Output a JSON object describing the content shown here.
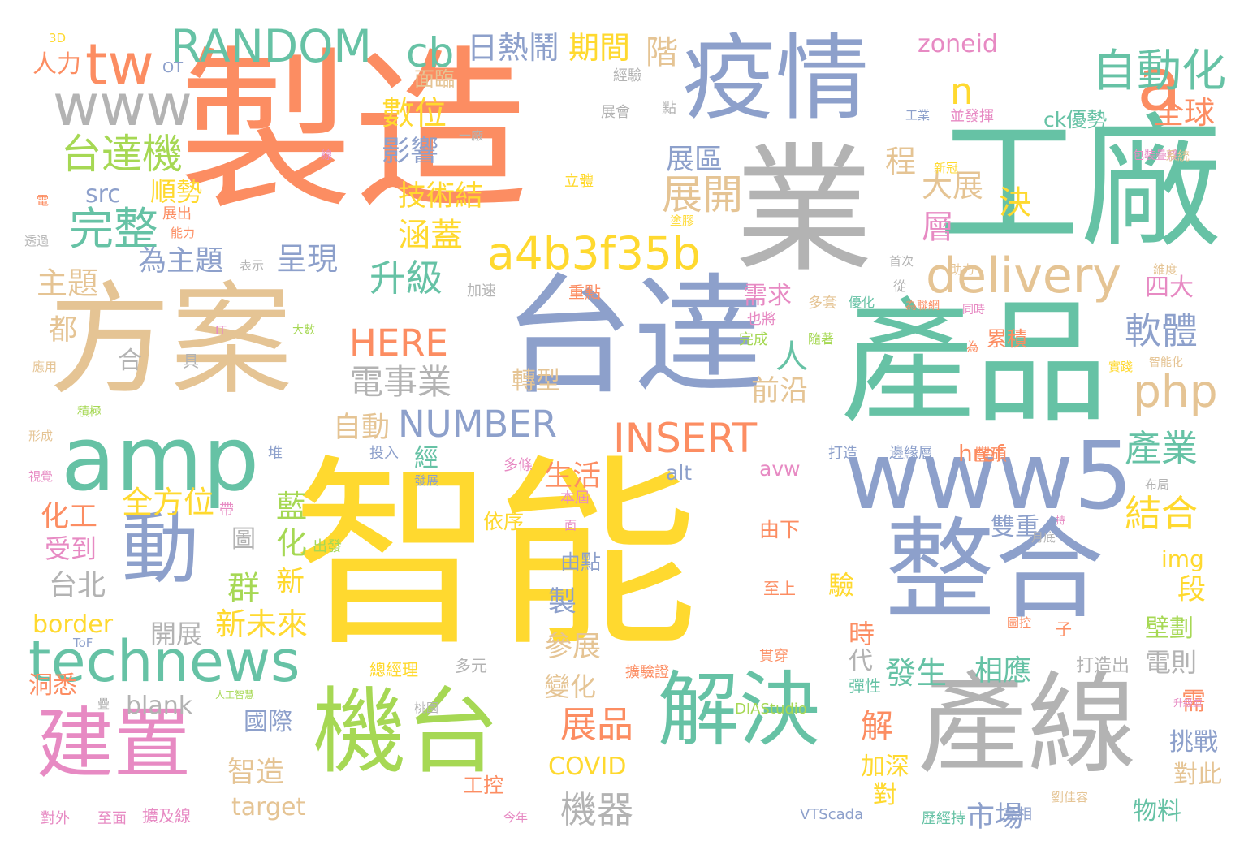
{
  "palette": {
    "orange": "#fc8d62",
    "green": "#66c2a5",
    "blue": "#8da0cb",
    "pink": "#e78ac3",
    "lime": "#a6d854",
    "yellow": "#ffd92f",
    "tan": "#e5c494",
    "gray": "#b3b3b3"
  },
  "words": [
    {
      "text": "智能",
      "color": "yellow"
    },
    {
      "text": "製造",
      "color": "orange"
    },
    {
      "text": "業",
      "color": "gray"
    },
    {
      "text": "工廠",
      "color": "green"
    },
    {
      "text": "疫情",
      "color": "blue"
    },
    {
      "text": "方案",
      "color": "tan"
    },
    {
      "text": "台達",
      "color": "blue"
    },
    {
      "text": "產品",
      "color": "green"
    },
    {
      "text": "產線",
      "color": "gray"
    },
    {
      "text": "整合",
      "color": "blue"
    },
    {
      "text": "機台",
      "color": "lime"
    },
    {
      "text": "解決",
      "color": "green"
    },
    {
      "text": "amp",
      "color": "green"
    },
    {
      "text": "www5",
      "color": "blue"
    },
    {
      "text": "建置",
      "color": "pink"
    },
    {
      "text": "動",
      "color": "blue"
    },
    {
      "text": "technews",
      "color": "green"
    },
    {
      "text": "a",
      "color": "orange"
    },
    {
      "text": "www",
      "color": "gray"
    },
    {
      "text": "tw",
      "color": "orange"
    },
    {
      "text": "RANDOM",
      "color": "green"
    },
    {
      "text": "a4b3f35b",
      "color": "yellow"
    },
    {
      "text": "delivery",
      "color": "tan"
    },
    {
      "text": "自動化",
      "color": "green"
    },
    {
      "text": "INSERT",
      "color": "orange"
    },
    {
      "text": "NUMBER",
      "color": "blue"
    },
    {
      "text": "HERE",
      "color": "orange"
    },
    {
      "text": "cb",
      "color": "green"
    },
    {
      "text": "n",
      "color": "yellow"
    },
    {
      "text": "php",
      "color": "tan"
    },
    {
      "text": "台達機",
      "color": "lime"
    },
    {
      "text": "完整",
      "color": "green"
    },
    {
      "text": "電事業",
      "color": "gray"
    },
    {
      "text": "展開",
      "color": "tan"
    },
    {
      "text": "升級",
      "color": "green"
    },
    {
      "text": "軟體",
      "color": "blue"
    },
    {
      "text": "結合",
      "color": "yellow"
    },
    {
      "text": "產業",
      "color": "green"
    },
    {
      "text": "展品",
      "color": "orange"
    },
    {
      "text": "機器",
      "color": "gray"
    },
    {
      "text": "日熱鬧",
      "color": "blue"
    },
    {
      "text": "期間",
      "color": "yellow"
    },
    {
      "text": "階",
      "color": "tan"
    },
    {
      "text": "數位",
      "color": "yellow"
    },
    {
      "text": "大展",
      "color": "tan"
    },
    {
      "text": "全球",
      "color": "orange"
    },
    {
      "text": "影響",
      "color": "blue"
    },
    {
      "text": "展區",
      "color": "blue"
    },
    {
      "text": "技術結",
      "color": "yellow"
    },
    {
      "text": "程",
      "color": "tan"
    },
    {
      "text": "決",
      "color": "yellow"
    },
    {
      "text": "層",
      "color": "pink"
    },
    {
      "text": "涵蓋",
      "color": "yellow"
    },
    {
      "text": "呈現",
      "color": "blue"
    },
    {
      "text": "為主題",
      "color": "blue"
    },
    {
      "text": "順勢",
      "color": "yellow"
    },
    {
      "text": "src",
      "color": "blue"
    },
    {
      "text": "主題",
      "color": "tan"
    },
    {
      "text": "人力",
      "color": "orange"
    },
    {
      "text": "都",
      "color": "tan"
    },
    {
      "text": "合",
      "color": "gray"
    },
    {
      "text": "人",
      "color": "green"
    },
    {
      "text": "四大",
      "color": "pink"
    },
    {
      "text": "需求",
      "color": "pink"
    },
    {
      "text": "前沿",
      "color": "tan"
    },
    {
      "text": "轉型",
      "color": "tan"
    },
    {
      "text": "自動",
      "color": "tan"
    },
    {
      "text": "全方位",
      "color": "yellow"
    },
    {
      "text": "化工",
      "color": "orange"
    },
    {
      "text": "受到",
      "color": "pink"
    },
    {
      "text": "台北",
      "color": "gray"
    },
    {
      "text": "群",
      "color": "lime"
    },
    {
      "text": "新",
      "color": "yellow"
    },
    {
      "text": "藍",
      "color": "lime"
    },
    {
      "text": "化",
      "color": "lime"
    },
    {
      "text": "經",
      "color": "green"
    },
    {
      "text": "生活",
      "color": "orange"
    },
    {
      "text": "新未來",
      "color": "yellow"
    },
    {
      "text": "開展",
      "color": "gray"
    },
    {
      "text": "參展",
      "color": "tan"
    },
    {
      "text": "變化",
      "color": "tan"
    },
    {
      "text": "border",
      "color": "yellow"
    },
    {
      "text": "blank",
      "color": "gray"
    },
    {
      "text": "國際",
      "color": "blue"
    },
    {
      "text": "智造",
      "color": "tan"
    },
    {
      "text": "target",
      "color": "tan"
    },
    {
      "text": "COVID",
      "color": "yellow"
    },
    {
      "text": "alt",
      "color": "blue"
    },
    {
      "text": "avw",
      "color": "pink"
    },
    {
      "text": "href",
      "color": "orange"
    },
    {
      "text": "img",
      "color": "yellow"
    },
    {
      "text": "段",
      "color": "yellow"
    },
    {
      "text": "壁劃",
      "color": "lime"
    },
    {
      "text": "雙重",
      "color": "blue"
    },
    {
      "text": "驗",
      "color": "yellow"
    },
    {
      "text": "時",
      "color": "orange"
    },
    {
      "text": "代",
      "color": "gray"
    },
    {
      "text": "發生",
      "color": "green"
    },
    {
      "text": "相應",
      "color": "green"
    },
    {
      "text": "電則",
      "color": "gray"
    },
    {
      "text": "解",
      "color": "orange"
    },
    {
      "text": "加深",
      "color": "yellow"
    },
    {
      "text": "對",
      "color": "yellow"
    },
    {
      "text": "需",
      "color": "orange"
    },
    {
      "text": "挑戰",
      "color": "blue"
    },
    {
      "text": "對此",
      "color": "tan"
    },
    {
      "text": "物料",
      "color": "green"
    },
    {
      "text": "市場",
      "color": "blue"
    },
    {
      "text": "製",
      "color": "blue"
    },
    {
      "text": "zoneid",
      "color": "pink"
    },
    {
      "text": "ck優勢",
      "color": "green"
    },
    {
      "text": "圖",
      "color": "gray"
    },
    {
      "text": "洞悉",
      "color": "orange"
    },
    {
      "text": "3D",
      "color": "yellow"
    },
    {
      "text": "OT",
      "color": "blue"
    },
    {
      "text": "經驗",
      "color": "gray"
    },
    {
      "text": "面臨",
      "color": "tan"
    },
    {
      "text": "展會",
      "color": "gray"
    },
    {
      "text": "點",
      "color": "gray"
    },
    {
      "text": "工業",
      "color": "blue"
    },
    {
      "text": "並發揮",
      "color": "pink"
    },
    {
      "text": "包裝疊棧",
      "color": "pink"
    },
    {
      "text": "系統",
      "color": "tan"
    },
    {
      "text": "新冠",
      "color": "yellow"
    },
    {
      "text": "立體",
      "color": "yellow"
    },
    {
      "text": "一廠",
      "color": "gray"
    },
    {
      "text": "線",
      "color": "pink"
    },
    {
      "text": "電",
      "color": "orange"
    },
    {
      "text": "展出",
      "color": "orange"
    },
    {
      "text": "能力",
      "color": "orange"
    },
    {
      "text": "透過",
      "color": "gray"
    },
    {
      "text": "塗膠",
      "color": "yellow"
    },
    {
      "text": "表示",
      "color": "gray"
    },
    {
      "text": "首次",
      "color": "gray"
    },
    {
      "text": "助力",
      "color": "tan"
    },
    {
      "text": "維度",
      "color": "tan"
    },
    {
      "text": "重點",
      "color": "orange"
    },
    {
      "text": "加速",
      "color": "gray"
    },
    {
      "text": "從",
      "color": "gray"
    },
    {
      "text": "多套",
      "color": "tan"
    },
    {
      "text": "優化",
      "color": "green"
    },
    {
      "text": "為聯網",
      "color": "orange"
    },
    {
      "text": "同時",
      "color": "pink"
    },
    {
      "text": "IT",
      "color": "pink"
    },
    {
      "text": "大數",
      "color": "lime"
    },
    {
      "text": "也將",
      "color": "pink"
    },
    {
      "text": "完成",
      "color": "lime"
    },
    {
      "text": "隨著",
      "color": "lime"
    },
    {
      "text": "累積",
      "color": "orange"
    },
    {
      "text": "為",
      "color": "orange"
    },
    {
      "text": "應用",
      "color": "tan"
    },
    {
      "text": "具",
      "color": "gray"
    },
    {
      "text": "實踐",
      "color": "yellow"
    },
    {
      "text": "智能化",
      "color": "tan"
    },
    {
      "text": "積極",
      "color": "lime"
    },
    {
      "text": "形成",
      "color": "tan"
    },
    {
      "text": "投入",
      "color": "blue"
    },
    {
      "text": "堆",
      "color": "blue"
    },
    {
      "text": "多條",
      "color": "pink"
    },
    {
      "text": "打造",
      "color": "blue"
    },
    {
      "text": "邊緣層",
      "color": "blue"
    },
    {
      "text": "豐碩",
      "color": "orange"
    },
    {
      "text": "視覺",
      "color": "pink"
    },
    {
      "text": "帶",
      "color": "pink"
    },
    {
      "text": "本屆",
      "color": "pink"
    },
    {
      "text": "布局",
      "color": "gray"
    },
    {
      "text": "發展",
      "color": "blue"
    },
    {
      "text": "依序",
      "color": "yellow"
    },
    {
      "text": "面",
      "color": "pink"
    },
    {
      "text": "持",
      "color": "pink"
    },
    {
      "text": "出發",
      "color": "lime"
    },
    {
      "text": "由下",
      "color": "orange"
    },
    {
      "text": "月底",
      "color": "gray"
    },
    {
      "text": "由點",
      "color": "blue"
    },
    {
      "text": "至上",
      "color": "orange"
    },
    {
      "text": "圖控",
      "color": "orange"
    },
    {
      "text": "子",
      "color": "orange"
    },
    {
      "text": "ToF",
      "color": "blue"
    },
    {
      "text": "總經理",
      "color": "yellow"
    },
    {
      "text": "多元",
      "color": "gray"
    },
    {
      "text": "擴驗證",
      "color": "orange"
    },
    {
      "text": "貫穿",
      "color": "orange"
    },
    {
      "text": "打造出",
      "color": "gray"
    },
    {
      "text": "疊",
      "color": "gray"
    },
    {
      "text": "人工智慧",
      "color": "lime"
    },
    {
      "text": "彈性",
      "color": "green"
    },
    {
      "text": "升級並",
      "color": "pink"
    },
    {
      "text": "桃園",
      "color": "gray"
    },
    {
      "text": "DIAStudio",
      "color": "lime"
    },
    {
      "text": "工控",
      "color": "orange"
    },
    {
      "text": "今年",
      "color": "pink"
    },
    {
      "text": "VTScada",
      "color": "blue"
    },
    {
      "text": "歷經持",
      "color": "green"
    },
    {
      "text": "亮相",
      "color": "blue"
    },
    {
      "text": "劉佳容",
      "color": "tan"
    },
    {
      "text": "對外",
      "color": "pink"
    },
    {
      "text": "至面",
      "color": "pink"
    },
    {
      "text": "擴及線",
      "color": "pink"
    }
  ]
}
